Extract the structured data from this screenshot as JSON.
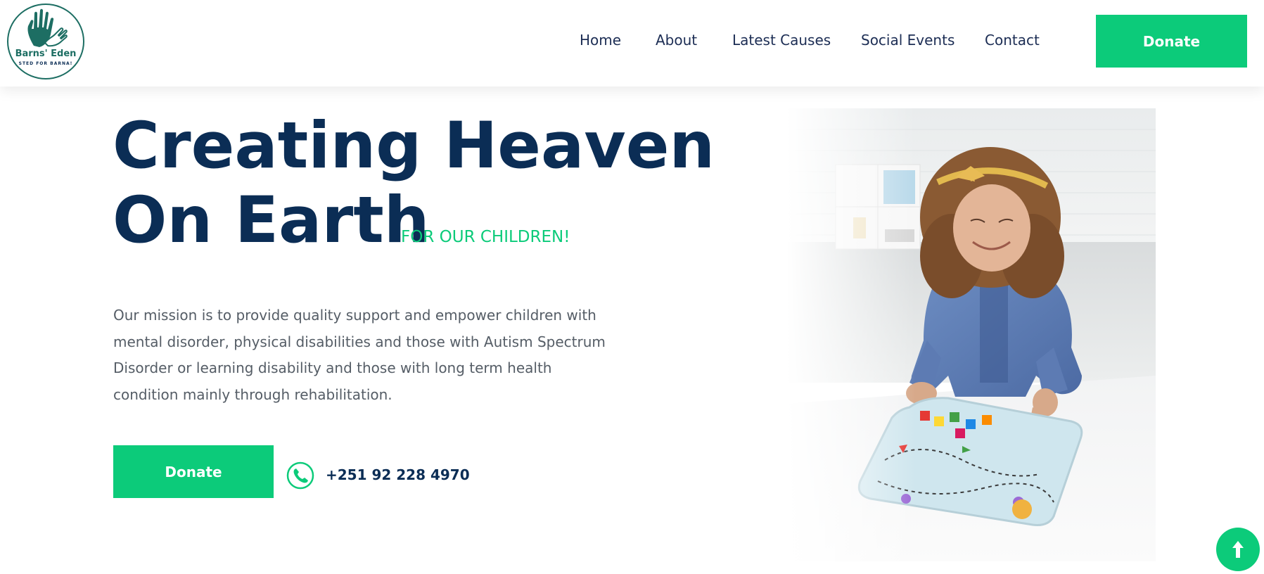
{
  "brand": {
    "name": "Barns' Eden",
    "tagline": "STED FOR BARNA!"
  },
  "nav": {
    "items": [
      {
        "label": "Home"
      },
      {
        "label": "About"
      },
      {
        "label": "Latest Causes"
      },
      {
        "label": "Social Events"
      },
      {
        "label": "Contact"
      }
    ],
    "donate_label": "Donate"
  },
  "hero": {
    "title_line1": "Creating Heaven",
    "title_line2": "On Earth",
    "tagline": "FOR OUR CHILDREN!",
    "mission": "Our mission is to provide quality support and empower children with mental disorder, physical disabilities and those with Autism Spectrum Disorder or learning disability and those with long term health condition mainly through rehabilitation.",
    "donate_label": "Donate",
    "phone": "+251 92 228 4970"
  },
  "colors": {
    "primary": "#0b2d55",
    "accent": "#0ccb7a",
    "logo": "#1d6e63"
  },
  "icons": {
    "phone": "phone-icon",
    "scroll_top": "arrow-up-icon"
  }
}
